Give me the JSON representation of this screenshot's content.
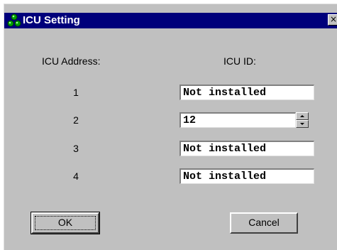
{
  "window": {
    "title": "ICU Setting",
    "icon": "network-nodes-icon",
    "close_label": "×"
  },
  "headers": {
    "address": "ICU Address:",
    "id": "ICU ID:"
  },
  "rows": [
    {
      "address": "1",
      "id": "Not installed"
    },
    {
      "address": "2",
      "id": "12"
    },
    {
      "address": "3",
      "id": "Not installed"
    },
    {
      "address": "4",
      "id": "Not installed"
    }
  ],
  "buttons": {
    "ok": "OK",
    "cancel": "Cancel"
  },
  "colors": {
    "titlebar": "#00007b",
    "face": "#c0c0c0",
    "icon_green": "#00a000"
  }
}
